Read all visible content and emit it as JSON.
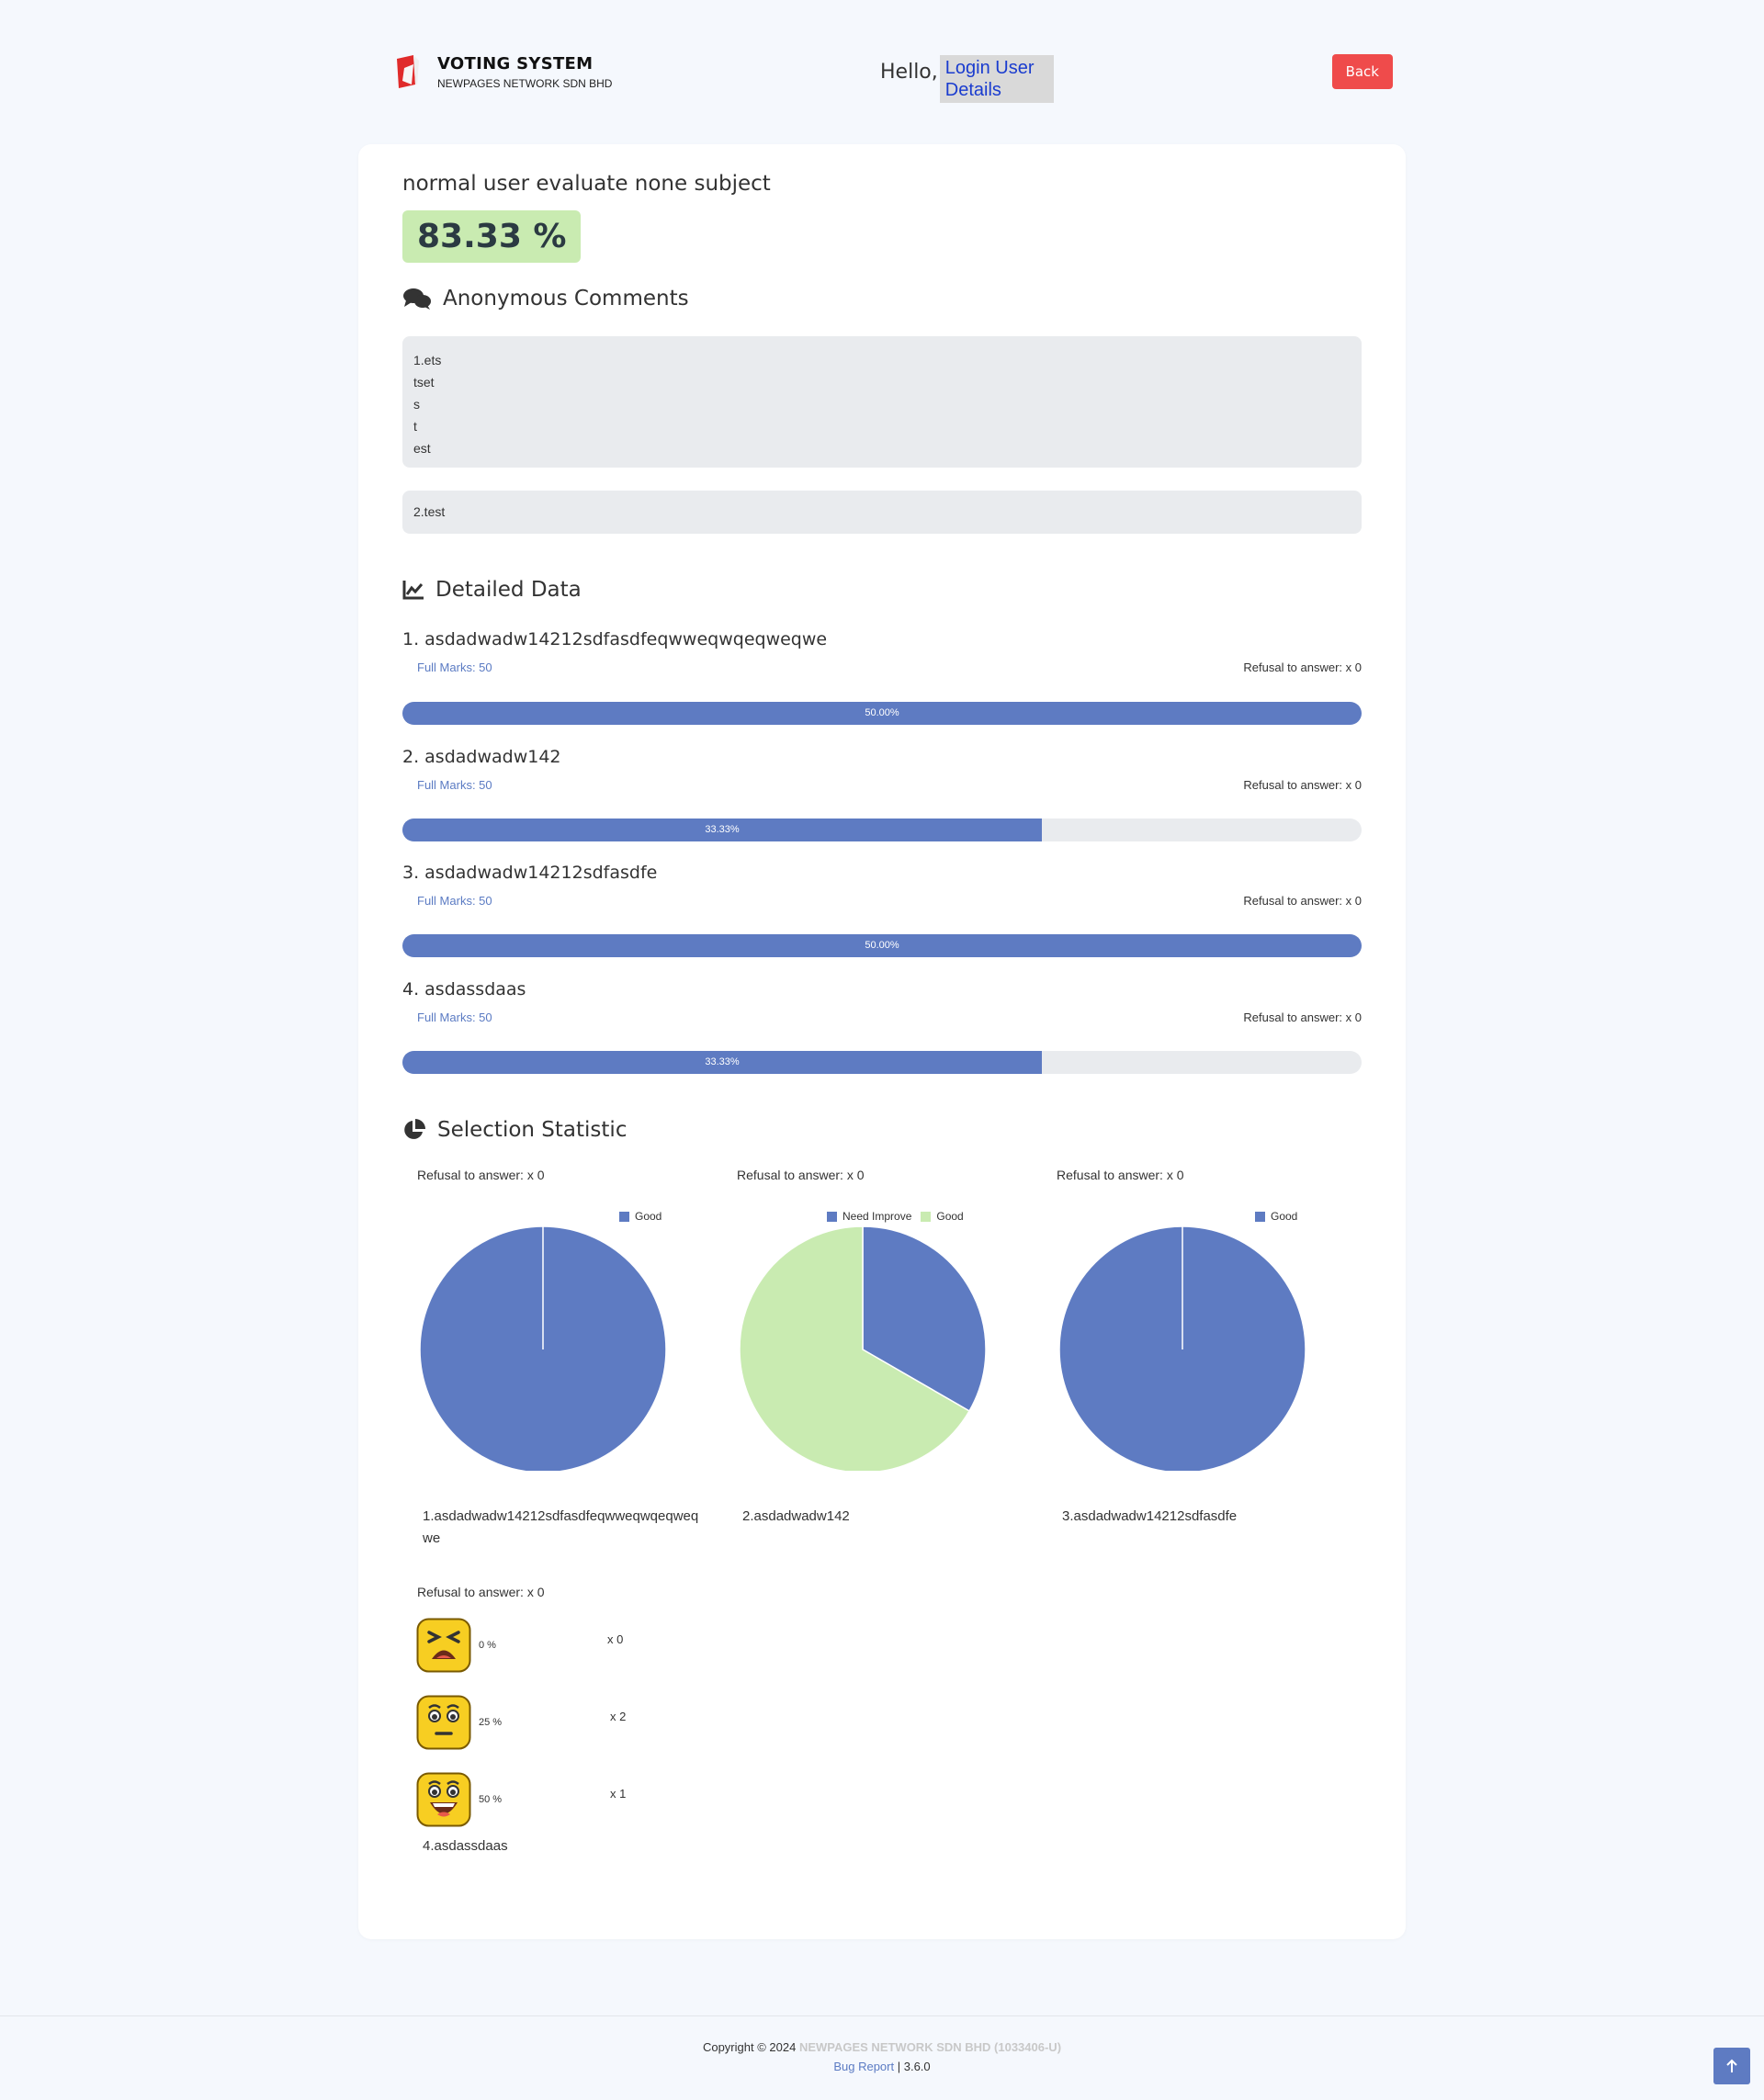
{
  "header": {
    "brand_title": "VOTING SYSTEM",
    "brand_subtitle": "NEWPAGES NETWORK SDN BHD",
    "hello": "Hello,",
    "login_link": "Login User Details",
    "back_button": "Back"
  },
  "subject": {
    "title": "normal user evaluate none subject",
    "score": "83.33 %"
  },
  "comments": {
    "title": "Anonymous Comments",
    "items": [
      "1.ets\ntset\ns\nt\nest",
      "2.test"
    ]
  },
  "detailed": {
    "title": "Detailed Data",
    "questions": [
      {
        "title": "1. asdadwadw14212sdfasdfeqwweqwqeqweqwe",
        "full_marks": "Full Marks: 50",
        "refusal": "Refusal to answer: x 0",
        "percent_label": "50.00%",
        "fill_fraction": 1.0
      },
      {
        "title": "2. asdadwadw142",
        "full_marks": "Full Marks: 50",
        "refusal": "Refusal to answer: x 0",
        "percent_label": "33.33%",
        "fill_fraction": 0.6667
      },
      {
        "title": "3. asdadwadw14212sdfasdfe",
        "full_marks": "Full Marks: 50",
        "refusal": "Refusal to answer: x 0",
        "percent_label": "50.00%",
        "fill_fraction": 1.0
      },
      {
        "title": "4. asdassdaas",
        "full_marks": "Full Marks: 50",
        "refusal": "Refusal to answer: x 0",
        "percent_label": "33.33%",
        "fill_fraction": 0.6667
      }
    ]
  },
  "selection": {
    "title": "Selection Statistic",
    "pies": [
      {
        "refusal": "Refusal to answer: x 0",
        "caption": "1.asdadwadw14212sdfasdfeqwweqwqeqweqwe"
      },
      {
        "refusal": "Refusal to answer: x 0",
        "caption": "2.asdadwadw142"
      },
      {
        "refusal": "Refusal to answer: x 0",
        "caption": "3.asdadwadw14212sdfasdfe"
      }
    ],
    "emoji": {
      "refusal": "Refusal to answer: x 0",
      "caption": "4.asdassdaas",
      "rows": [
        {
          "icon": "tired-face-icon",
          "percent": "0 %",
          "count": "x 0"
        },
        {
          "icon": "neutral-face-icon",
          "percent": "25 %",
          "count": "x 2"
        },
        {
          "icon": "happy-face-icon",
          "percent": "50 %",
          "count": "x 1"
        }
      ]
    }
  },
  "chart_data": [
    {
      "type": "pie",
      "categories": [
        "Good"
      ],
      "values": [
        1
      ],
      "colors": [
        "#5e7bc2"
      ],
      "legend": "top-right"
    },
    {
      "type": "pie",
      "categories": [
        "Need Improve",
        "Good"
      ],
      "values": [
        1,
        2
      ],
      "colors": [
        "#5e7bc2",
        "#c9ebb1"
      ],
      "legend": "top-right"
    },
    {
      "type": "pie",
      "categories": [
        "Good"
      ],
      "values": [
        1
      ],
      "colors": [
        "#5e7bc2"
      ],
      "legend": "top-right"
    }
  ],
  "footer": {
    "copyright": "Copyright © 2024",
    "company": "NEWPAGES NETWORK SDN BHD (1033406-U)",
    "bug_report": "Bug Report",
    "version": "| 3.6.0"
  },
  "colors": {
    "accent": "#5e7bc2",
    "score_bg": "#c9ebb1",
    "back_button": "#ef4b4b",
    "comment_bg": "#e9ebee"
  }
}
